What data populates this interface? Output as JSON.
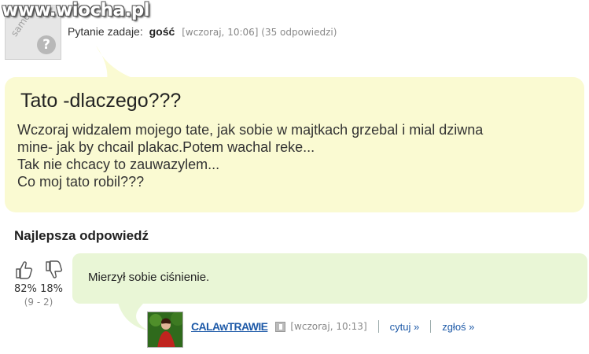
{
  "watermark": "www.wiocha.pl",
  "question": {
    "avatar_text": "samosia",
    "ask_label": "Pytanie zadaje:",
    "user": "gość",
    "meta": "[wczoraj, 10:06] (35 odpowiedzi)",
    "title": "Tato -dlaczego???",
    "body_lines": [
      "Wczoraj widzalem mojego tate, jak sobie w majtkach grzebal i mial dziwna",
      "mine- jak by chcail plakac.Potem wachal reke...",
      "Tak nie chcacy to zauwazylem...",
      "Co moj tato robil???"
    ]
  },
  "best_answer": {
    "label": "Najlepsza odpowiedź",
    "text": "Mierzył sobie ciśnienie.",
    "votes": {
      "up_pct": "82%",
      "down_pct": "18%",
      "counts": "(9 - 2)"
    },
    "user": "CALAwTRAWIE",
    "time": "[wczoraj, 10:13]",
    "quote_link": "cytuj »",
    "report_link": "zgłoś »"
  },
  "colors": {
    "question_bubble": "#fafad2",
    "answer_bubble": "#e9f6d6",
    "link": "#1e5aa8"
  },
  "icons": [
    "question-mark-icon",
    "thumbs-up-icon",
    "thumbs-down-icon",
    "user-badge-icon"
  ]
}
